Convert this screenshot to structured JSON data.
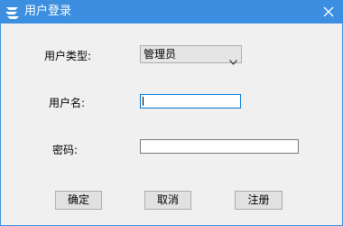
{
  "window": {
    "title": "用户登录",
    "close_glyph": "close-icon",
    "app_icon": "app-logo-icon"
  },
  "form": {
    "user_type": {
      "label": "用户类型:",
      "selected": "管理员"
    },
    "username": {
      "label": "用户名:",
      "value": ""
    },
    "password": {
      "label": "密码:",
      "value": ""
    }
  },
  "buttons": {
    "ok": "确定",
    "cancel": "取消",
    "register": "注册"
  },
  "colors": {
    "titlebar": "#3c8fe0",
    "focus_border": "#0078d7"
  }
}
